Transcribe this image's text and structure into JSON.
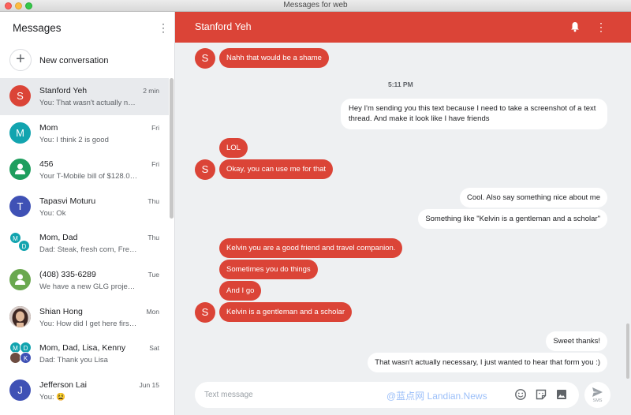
{
  "window": {
    "title": "Messages for web"
  },
  "sidebar": {
    "title": "Messages",
    "new_conversation_label": "New conversation",
    "conversations": [
      {
        "name": "Stanford Yeh",
        "time": "2 min",
        "snippet": "You: That wasn't actually nec...",
        "avatar_letter": "S",
        "avatar_color": "#db4437"
      },
      {
        "name": "Mom",
        "time": "Fri",
        "snippet": "You: I think 2 is good",
        "avatar_letter": "M",
        "avatar_color": "#12a4af"
      },
      {
        "name": "456",
        "time": "Fri",
        "snippet": "Your T-Mobile bill of $128.00...",
        "avatar_icon": "person-icon",
        "avatar_color": "#1e9e5e"
      },
      {
        "name": "Tapasvi Moturu",
        "time": "Thu",
        "snippet": "You: Ok",
        "avatar_letter": "T",
        "avatar_color": "#3f51b5"
      },
      {
        "name": "Mom, Dad",
        "time": "Thu",
        "snippet": "Dad: Steak, fresh corn, Frenc...",
        "avatar_letters": [
          "M",
          "D"
        ],
        "avatar_colors": [
          "#12a4af",
          "#12a4af"
        ]
      },
      {
        "name": "(408) 335-6289",
        "time": "Tue",
        "snippet": "We have a new GLG project ...",
        "avatar_icon": "person-icon",
        "avatar_color": "#6aa84f"
      },
      {
        "name": "Shian Hong",
        "time": "Mon",
        "snippet": "You: How did I get here first l...",
        "avatar_photo": true
      },
      {
        "name": "Mom, Dad, Lisa, Kenny",
        "time": "Sat",
        "snippet": "Dad: Thank you Lisa",
        "avatar_letters": [
          "M",
          "D",
          "",
          "K"
        ],
        "avatar_colors": [
          "#12a4af",
          "#12a4af",
          "#6d4c41",
          "#3f51b5"
        ]
      },
      {
        "name": "Jefferson Lai",
        "time": "Jun 15",
        "snippet": "You: 😫",
        "avatar_letter": "J",
        "avatar_color": "#3f51b5"
      }
    ]
  },
  "chat": {
    "title": "Stanford Yeh",
    "timestamp": "5:11 PM",
    "messages": [
      {
        "dir": "in",
        "text": "Nahh that would be a shame"
      },
      {
        "dir": "out",
        "text": "Hey I'm sending you this text because I need to take a screenshot of a text thread. And make it look like I have friends"
      },
      {
        "dir": "in",
        "text": "LOL"
      },
      {
        "dir": "in",
        "text": "Okay, you can use me for that"
      },
      {
        "dir": "out",
        "text": "Cool. Also say something nice about me"
      },
      {
        "dir": "out",
        "text": "Something like \"Kelvin is a gentleman and a scholar\""
      },
      {
        "dir": "in",
        "text": "Kelvin you are a good friend and travel companion."
      },
      {
        "dir": "in",
        "text": "Sometimes you do things"
      },
      {
        "dir": "in",
        "text": "And I go"
      },
      {
        "dir": "in",
        "text": "Kelvin is a gentleman and a scholar"
      },
      {
        "dir": "out",
        "text": "Sweet thanks!"
      },
      {
        "dir": "out",
        "text": "That wasn't actually necessary, I just wanted to hear that form you :)"
      }
    ],
    "sender_initial": "S"
  },
  "composer": {
    "placeholder": "Text message",
    "send_label": "SMS",
    "watermark": "@蓝点网 Landian.News"
  },
  "colors": {
    "accent": "#db4437",
    "chat_bg": "#eef0f2"
  }
}
